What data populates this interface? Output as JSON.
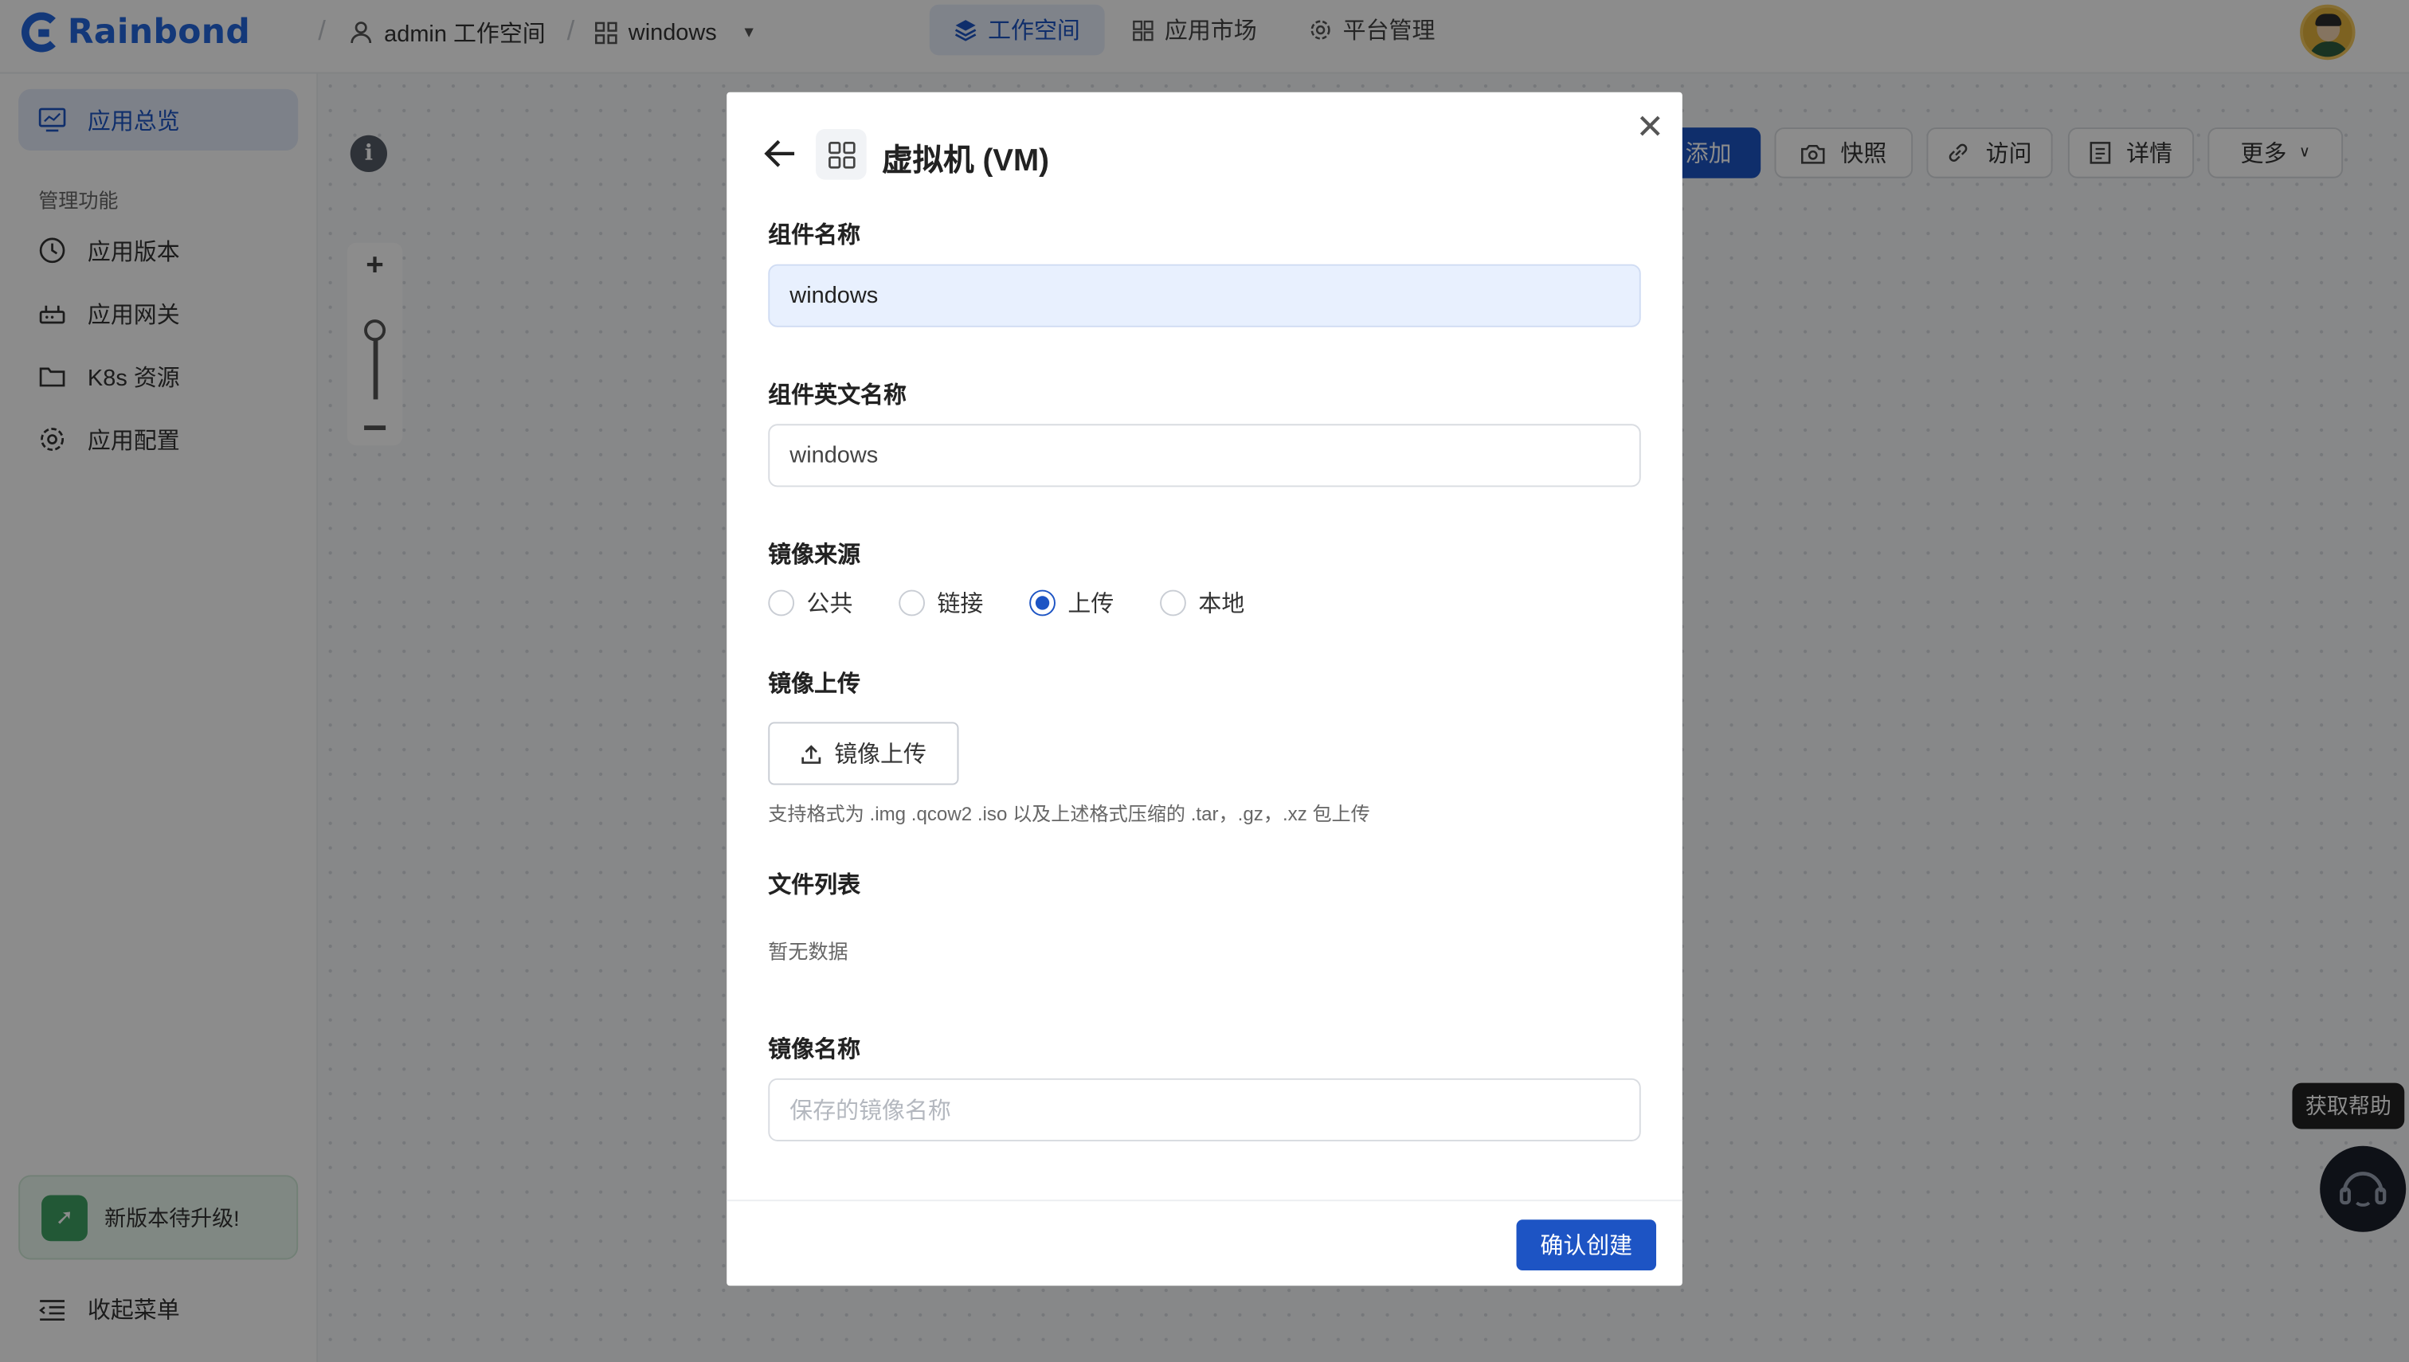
{
  "header": {
    "brand": "Rainbond",
    "workspace": "admin 工作空间",
    "app": "windows",
    "nav": [
      {
        "label": "工作空间",
        "icon": "layers-icon",
        "active": true
      },
      {
        "label": "应用市场",
        "icon": "grid-icon",
        "active": false
      },
      {
        "label": "平台管理",
        "icon": "gear-icon",
        "active": false
      }
    ]
  },
  "sidebar": {
    "overview": "应用总览",
    "group_label": "管理功能",
    "items": [
      {
        "label": "应用版本",
        "icon": "clock-icon"
      },
      {
        "label": "应用网关",
        "icon": "router-icon"
      },
      {
        "label": "K8s 资源",
        "icon": "folder-icon"
      },
      {
        "label": "应用配置",
        "icon": "gear-icon"
      }
    ],
    "upgrade": "新版本待升级!",
    "collapse": "收起菜单"
  },
  "toolbar": {
    "add": "添加",
    "snapshot": "快照",
    "visit": "访问",
    "detail": "详情",
    "more": "更多"
  },
  "help": {
    "tooltip": "获取帮助"
  },
  "modal": {
    "title": "虚拟机 (VM)",
    "name_label": "组件名称",
    "name_value": "windows",
    "en_name_label": "组件英文名称",
    "en_name_value": "windows",
    "source_label": "镜像来源",
    "source_options": [
      "公共",
      "链接",
      "上传",
      "本地"
    ],
    "source_selected": "上传",
    "upload_label": "镜像上传",
    "upload_button": "镜像上传",
    "upload_hint": "支持格式为 .img .qcow2 .iso 以及上述格式压缩的 .tar，.gz，.xz 包上传",
    "file_list_label": "文件列表",
    "file_list_empty": "暂无数据",
    "image_name_label": "镜像名称",
    "image_name_placeholder": "保存的镜像名称",
    "confirm": "确认创建"
  },
  "colors": {
    "primary": "#1d54c4",
    "brand": "#2466dc",
    "mask": "rgba(0,0,0,0.45)"
  }
}
